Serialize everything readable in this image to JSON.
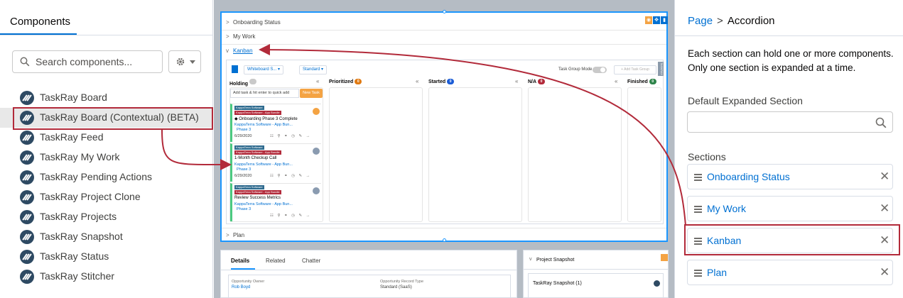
{
  "left_panel": {
    "tab_label": "Components",
    "search_placeholder": "Search components...",
    "components": [
      {
        "label": "TaskRay Board",
        "selected": false
      },
      {
        "label": "TaskRay Board (Contextual) (BETA)",
        "selected": true
      },
      {
        "label": "TaskRay Feed",
        "selected": false
      },
      {
        "label": "TaskRay My Work",
        "selected": false
      },
      {
        "label": "TaskRay Pending Actions",
        "selected": false
      },
      {
        "label": "TaskRay Project Clone",
        "selected": false
      },
      {
        "label": "TaskRay Projects",
        "selected": false
      },
      {
        "label": "TaskRay Snapshot",
        "selected": false
      },
      {
        "label": "TaskRay Status",
        "selected": false
      },
      {
        "label": "TaskRay Stitcher",
        "selected": false
      }
    ]
  },
  "canvas": {
    "accordion": {
      "sections": [
        "Onboarding Status",
        "My Work",
        "Kanban",
        "Plan"
      ]
    },
    "kanban": {
      "board_select": "Whiteboard S...",
      "view_select": "Standard",
      "task_group_mode": "Task Group Mode",
      "add_task_group": "+ Add Task Group",
      "side_tab": "TASKRAY",
      "quick_add": "Add task & hit enter to quick add",
      "new_task": "New Task",
      "columns": [
        {
          "name": "Holding",
          "count": "",
          "count_color": "#c9c9c9"
        },
        {
          "name": "Prioritized",
          "count": "0",
          "count_color": "#e07a12"
        },
        {
          "name": "Started",
          "count": "0",
          "count_color": "#1b5cd6"
        },
        {
          "name": "N/A",
          "count": "0",
          "count_color": "#b22a3a"
        },
        {
          "name": "Finished",
          "count": "0",
          "count_color": "#2e844a"
        }
      ],
      "tasks": [
        {
          "tag1": "KappaTerra Software",
          "tag2": "KappaTerra Software - App Bundle",
          "title": "◆ Onboarding Phase 3 Complete",
          "project": "KappaTerra Software - App Bun...",
          "phase": "Phase 3",
          "date": "6/29/2020",
          "avatar": "orange"
        },
        {
          "tag1": "KappaTerra Software",
          "tag2": "KappaTerra Software - App Bundle",
          "title": "1-Month Checkup Call",
          "project": "KappaTerra Software - App Bun...",
          "phase": "Phase 3",
          "date": "6/29/2020",
          "avatar": "grey"
        },
        {
          "tag1": "KappaTerra Software",
          "tag2": "KappaTerra Software - App Bundle",
          "title": "Review Success Metrics",
          "project": "KappaTerra Software - App Bun...",
          "phase": "Phase 3",
          "date": "",
          "avatar": "grey"
        }
      ]
    },
    "details_card": {
      "tabs": [
        "Details",
        "Related",
        "Chatter"
      ],
      "field1_label": "Opportunity Owner",
      "field1_value": "Rob Boyd",
      "field2_label": "Opportunity Record Type",
      "field2_value": "Standard (SaaS)"
    },
    "snapshot_card": {
      "title": "Project Snapshot",
      "item": "TaskRay Snapshot (1)"
    }
  },
  "right_panel": {
    "breadcrumb_page": "Page",
    "breadcrumb_current": "Accordion",
    "description": "Each section can hold one or more components. Only one section is expanded at a time.",
    "default_expanded_label": "Default Expanded Section",
    "default_expanded_value": "",
    "sections_label": "Sections",
    "sections": [
      "Onboarding Status",
      "My Work",
      "Kanban",
      "Plan"
    ]
  },
  "colors": {
    "brand_blue": "#0070d2",
    "highlight_red": "#b22a3a",
    "selection_blue": "#1b96ff",
    "orange": "#f4a343"
  }
}
